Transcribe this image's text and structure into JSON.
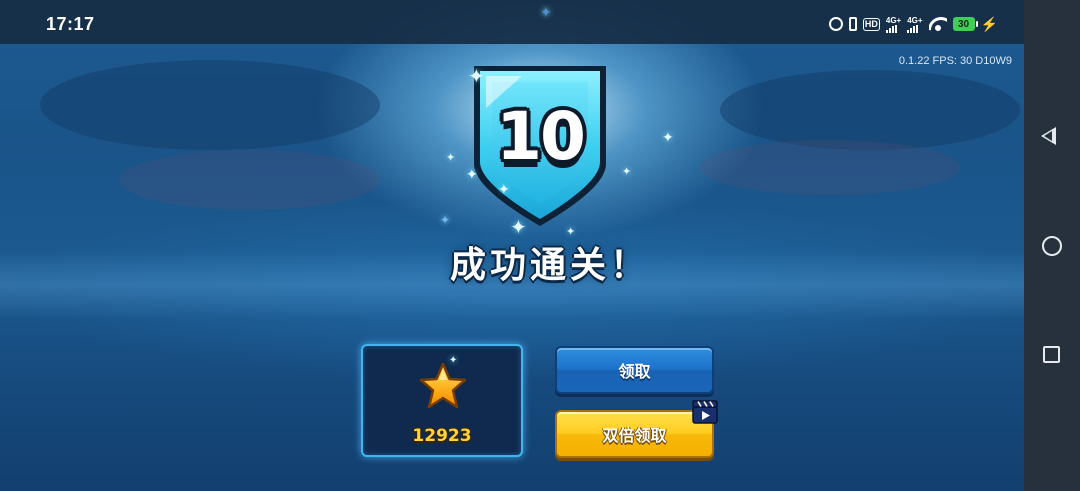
{
  "status_bar": {
    "time": "17:17",
    "net1": "4G+",
    "net2": "4G+",
    "hd_label": "HD",
    "battery_level": "30",
    "icons": [
      "alarm-icon",
      "vibrate-icon",
      "hd-icon",
      "signal-4g-icon",
      "signal-4g-icon",
      "wifi-icon",
      "battery-icon",
      "charging-icon"
    ]
  },
  "debug": {
    "fps_text": "0.1.22  FPS:  30  D10W9"
  },
  "level": {
    "number": "10",
    "title": "成功通关！"
  },
  "reward": {
    "icon": "star-icon",
    "count": "12923"
  },
  "buttons": {
    "claim_label": "领取",
    "double_claim_label": "双倍领取",
    "double_claim_icon": "video-clapper-icon"
  },
  "nav_bar": {
    "icons": [
      "back-icon",
      "home-icon",
      "recents-icon"
    ]
  },
  "colors": {
    "badge_cyan": "#3fd0f0",
    "claim_blue": "#1d72c9",
    "double_gold": "#ffcc1f",
    "reward_count_gold": "#ffd43a",
    "panel_border": "#3fb6f2"
  }
}
